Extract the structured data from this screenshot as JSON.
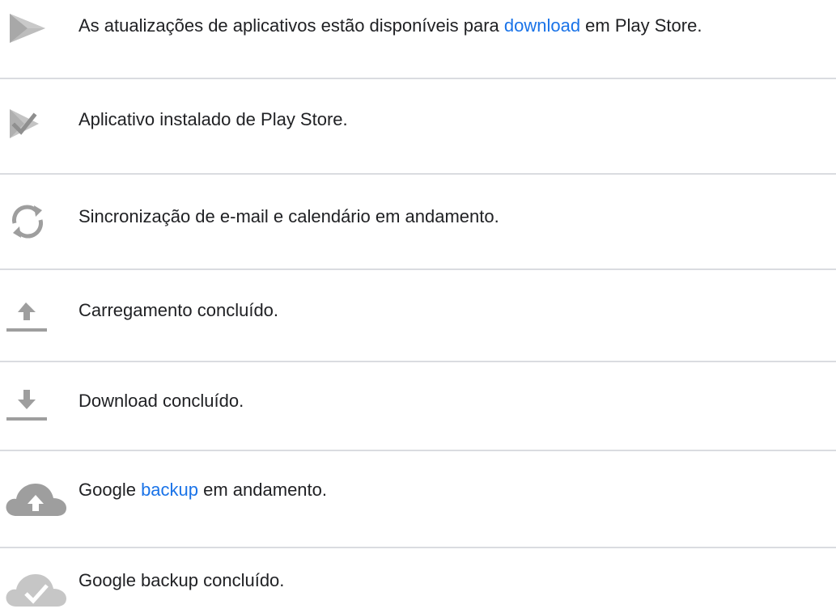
{
  "rows": [
    {
      "icon": "play-store-update-icon",
      "text_before": "As atualizações de aplicativos estão disponíveis para ",
      "link": "download",
      "text_after": " em Play Store."
    },
    {
      "icon": "play-store-installed-icon",
      "text": "Aplicativo instalado de Play Store."
    },
    {
      "icon": "sync-icon",
      "text": "Sincronização de e-mail e calendário em andamento."
    },
    {
      "icon": "upload-complete-icon",
      "text": "Carregamento concluído."
    },
    {
      "icon": "download-complete-icon",
      "text": "Download concluído."
    },
    {
      "icon": "cloud-upload-icon",
      "text_before": "Google ",
      "link": "backup",
      "text_after": " em andamento."
    },
    {
      "icon": "cloud-done-icon",
      "text": "Google backup concluído."
    }
  ],
  "colors": {
    "icon": "#9e9e9e",
    "text": "#202124",
    "link": "#1a73e8",
    "divider": "#dadce0"
  }
}
